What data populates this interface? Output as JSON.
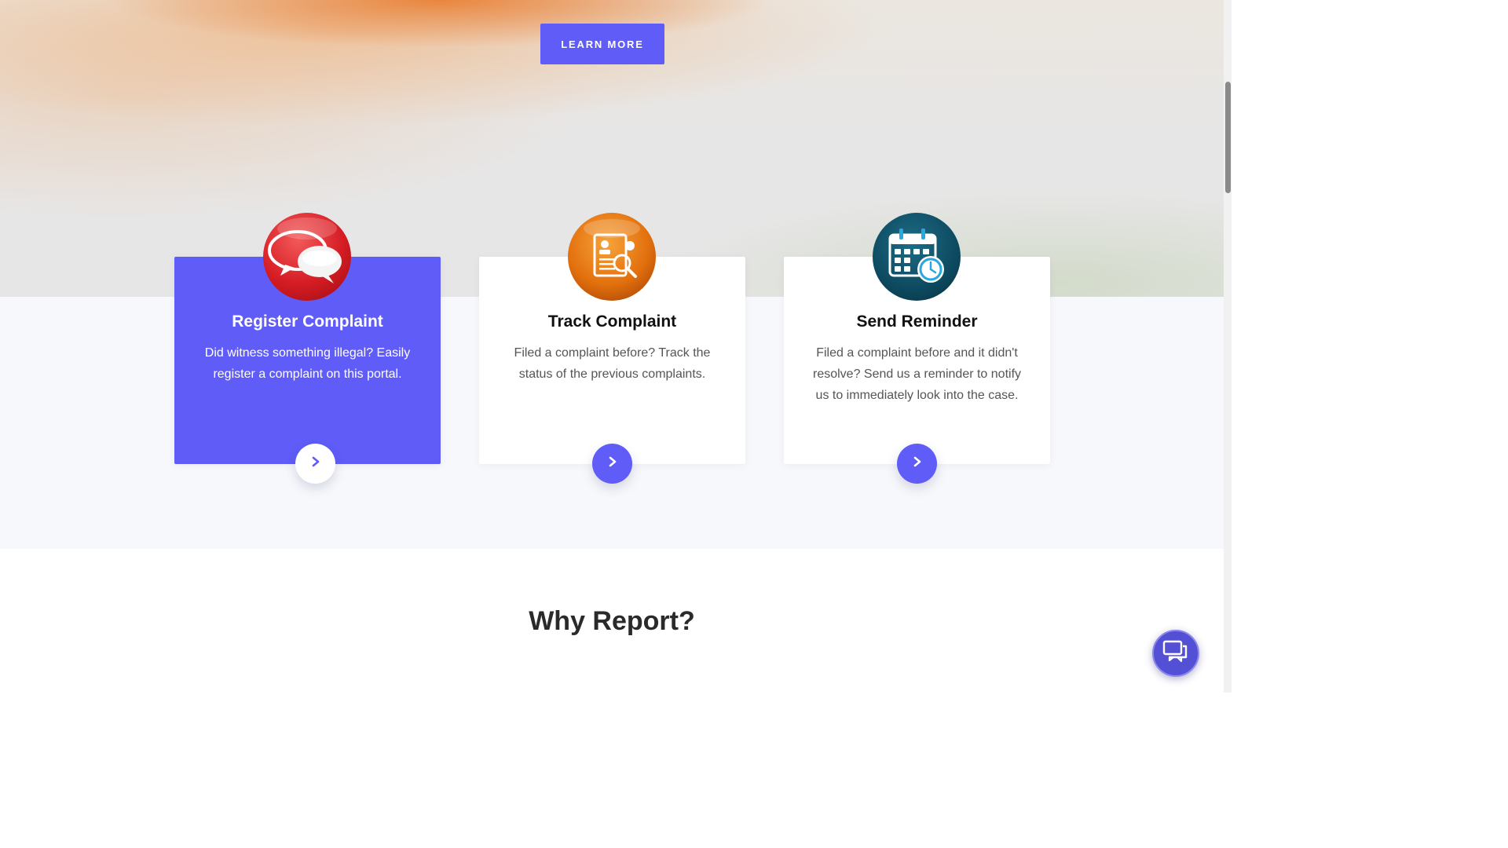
{
  "hero": {
    "cta_label": "LEARN MORE"
  },
  "services": {
    "cards": [
      {
        "title": "Register Complaint",
        "description": "Did witness something illegal? Easily register a complaint on this portal.",
        "icon": "speech-bubbles-icon",
        "active": true
      },
      {
        "title": "Track Complaint",
        "description": "Filed a complaint before? Track the status of the previous complaints.",
        "icon": "document-search-icon",
        "active": false
      },
      {
        "title": "Send Reminder",
        "description": "Filed a complaint before and it didn't resolve? Send us a reminder to notify us to immediately look into the case.",
        "icon": "calendar-clock-icon",
        "active": false
      }
    ]
  },
  "why_section": {
    "title": "Why Report?"
  },
  "colors": {
    "accent": "#5f5cf7",
    "chat_button": "#5450d6"
  }
}
